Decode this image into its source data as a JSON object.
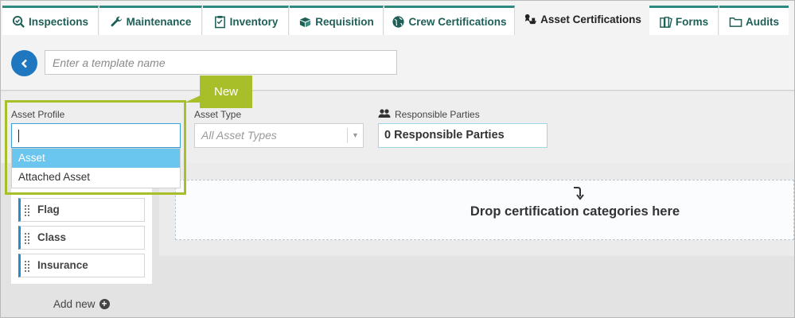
{
  "tabs": [
    {
      "label": "Inspections",
      "icon": "search-check-icon"
    },
    {
      "label": "Maintenance",
      "icon": "wrench-icon"
    },
    {
      "label": "Inventory",
      "icon": "clipboard-icon"
    },
    {
      "label": "Requisition",
      "icon": "boxes-icon"
    },
    {
      "label": "Crew Certifications",
      "icon": "globe-icon"
    },
    {
      "label": "Asset Certifications",
      "icon": "ship-certificate-icon",
      "active": true
    },
    {
      "label": "Forms",
      "icon": "forms-icon"
    },
    {
      "label": "Audits",
      "icon": "folder-icon"
    }
  ],
  "template": {
    "placeholder": "Enter a template name",
    "value": ""
  },
  "callout": {
    "label": "New"
  },
  "filters": {
    "asset_profile": {
      "label": "Asset Profile",
      "value": "",
      "options": [
        "Asset",
        "Attached Asset"
      ],
      "highlighted": "Asset"
    },
    "asset_type": {
      "label": "Asset Type",
      "placeholder": "All Asset Types"
    },
    "responsible_parties": {
      "label": "Responsible Parties",
      "value": "0 Responsible Parties"
    }
  },
  "categories": [
    "Flag",
    "Class",
    "Insurance"
  ],
  "add_new_label": "Add new",
  "drop_zone": {
    "text": "Drop certification categories here"
  },
  "colors": {
    "accent": "#2e8a7e",
    "primary": "#1f77c0",
    "highlight": "#a9bf2a",
    "selected_option": "#6ac6ee"
  }
}
